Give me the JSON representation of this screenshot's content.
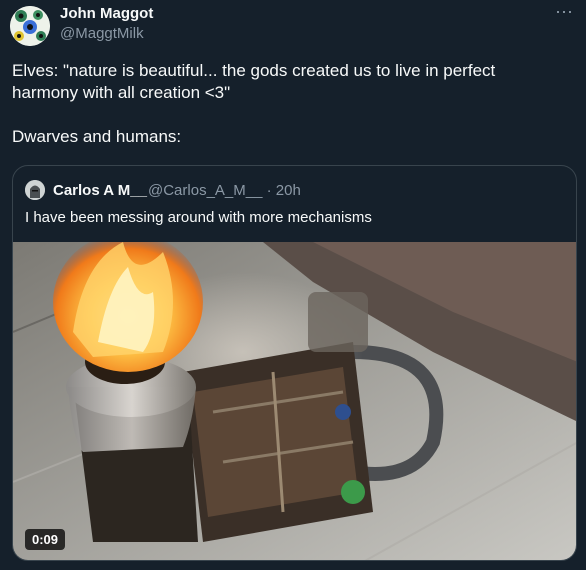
{
  "tweet": {
    "author_name": "John Maggot",
    "author_handle": "@MaggtMilk",
    "more_icon": "⋯",
    "body_lines": [
      "Elves: \"nature is beautiful... the gods created us to live in perfect",
      "harmony with all creation <3\"",
      "",
      "Dwarves and humans:"
    ]
  },
  "quote": {
    "author_name": "Carlos A M__",
    "author_handle": "@Carlos_A_M__ · 20h",
    "text": "I have been messing around with more mechanisms",
    "video_duration": "0:09"
  },
  "colors": {
    "background": "#15202b",
    "border": "#38444d",
    "secondary_text": "#8b98a5"
  }
}
